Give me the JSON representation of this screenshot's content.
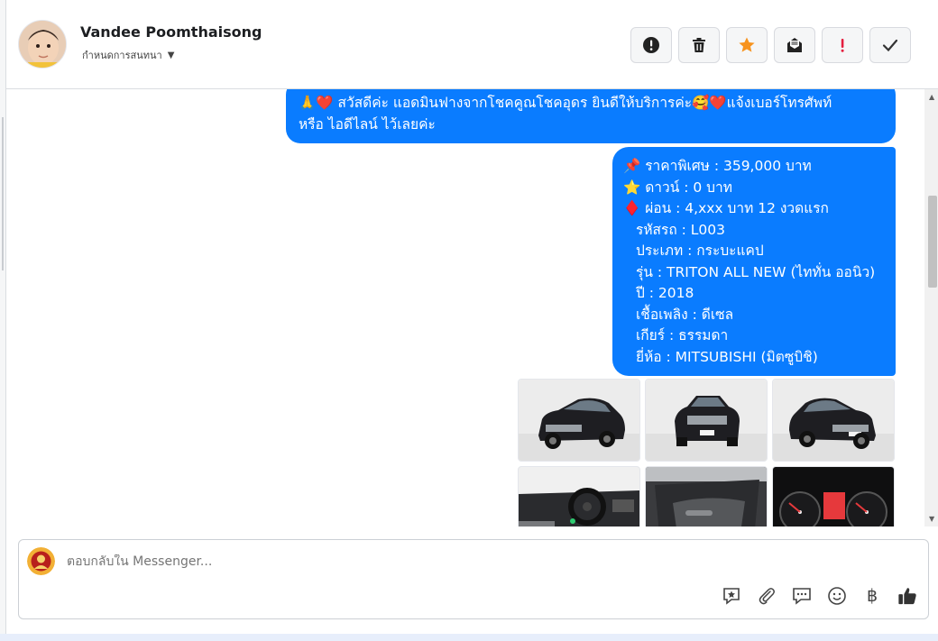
{
  "contact": {
    "name": "Vandee Poomthaisong",
    "assign_label": "กำหนดการสนทนา"
  },
  "header_actions": [
    {
      "name": "report-icon",
      "glyph": "!"
    },
    {
      "name": "trash-icon",
      "glyph": ""
    },
    {
      "name": "star-icon",
      "glyph": "★"
    },
    {
      "name": "mark-unread-icon",
      "glyph": ""
    },
    {
      "name": "priority-icon",
      "glyph": "!"
    },
    {
      "name": "done-check-icon",
      "glyph": "✓"
    }
  ],
  "messages": {
    "greeting_line1": "🙏❤️ สวัสดีค่ะ แอดมินฟางจากโชคคูณโชคอุดร ยินดีให้บริการค่ะ🥰❤️แจ้งเบอร์โทรศัพท์",
    "greeting_line2": "หรือ ไอดีไลน์  ไว้เลยค่ะ",
    "details": {
      "price": "📌 ราคาพิเศษ : 359,000 บาท",
      "down": "⭐ ดาวน์ : 0 บาท",
      "installment": "♦️ ผ่อน : 4,xxx บาท 12 งวดแรก",
      "code": "รหัสรถ : L003",
      "type": "ประเภท : กระบะแคป",
      "model": "รุ่น : TRITON ALL NEW (ไททั่น ออนิว)",
      "year": "ปี : 2018",
      "fuel": "เชื้อเพลิง : ดีเซล",
      "gear": "เกียร์ : ธรรมดา",
      "brand": "ยี่ห้อ : MITSUBISHI (มิตซูบิชิ)"
    }
  },
  "composer": {
    "placeholder": "ตอบกลับใน Messenger...",
    "tools": [
      "saved-reply-icon",
      "attach-icon",
      "chat-bubble-icon",
      "emoji-icon",
      "baht-icon",
      "thumbs-up-icon"
    ]
  },
  "colors": {
    "bubble": "#0a7cff",
    "star": "#f7931e",
    "priority": "#e41e3f"
  }
}
